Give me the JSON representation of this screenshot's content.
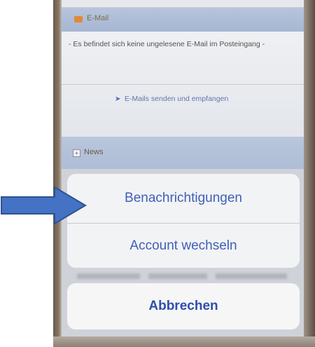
{
  "mail": {
    "title": "E-Mail",
    "status_text": "- Es befindet sich keine ungelesene E-Mail im Posteingang -",
    "send_receive_label": "E-Mails senden und empfangen",
    "icon": "envelope-icon",
    "send_icon": "send-arrow-icon"
  },
  "news": {
    "title": "News",
    "icon": "expand-plus-icon"
  },
  "action_sheet": {
    "options": [
      {
        "label": "Benachrichtigungen"
      },
      {
        "label": "Account wechseln"
      }
    ],
    "cancel_label": "Abbrechen"
  },
  "annotation": {
    "arrow_icon": "pointer-arrow-icon",
    "arrow_color": "#4472c4"
  },
  "colors": {
    "action_text": "#3f5fb8",
    "header_bar": "#b7c5dc"
  }
}
